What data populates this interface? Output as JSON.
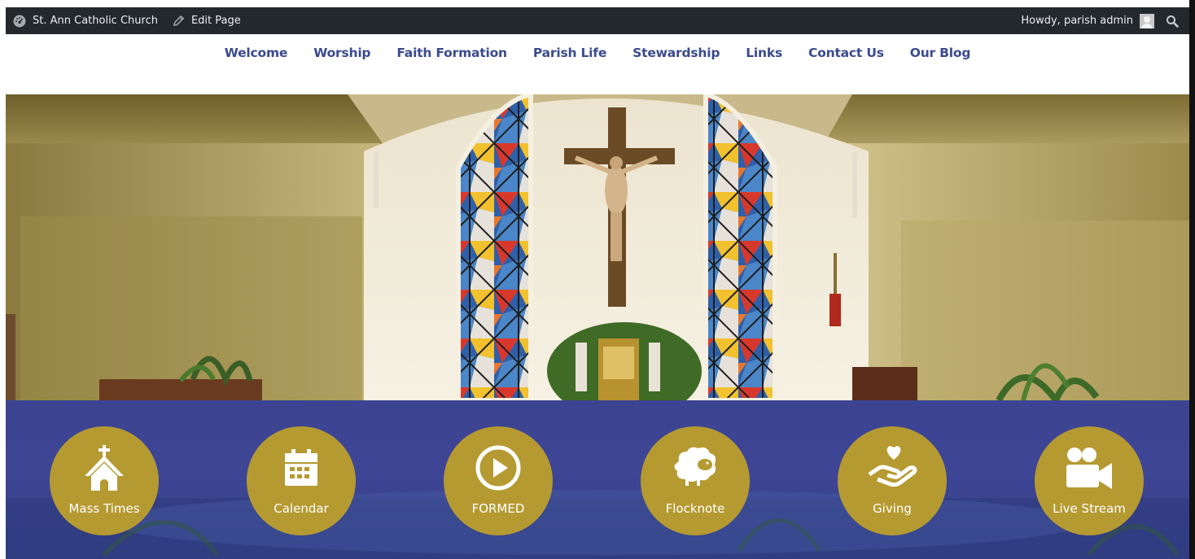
{
  "adminbar": {
    "site_name": "St. Ann Catholic Church",
    "edit_page": "Edit Page",
    "greeting": "Howdy, parish admin"
  },
  "nav": {
    "items": [
      {
        "label": "Welcome"
      },
      {
        "label": "Worship"
      },
      {
        "label": "Faith Formation"
      },
      {
        "label": "Parish Life"
      },
      {
        "label": "Stewardship"
      },
      {
        "label": "Links"
      },
      {
        "label": "Contact Us"
      },
      {
        "label": "Our Blog"
      }
    ]
  },
  "quicklinks": [
    {
      "label": "Mass Times",
      "icon": "church-icon"
    },
    {
      "label": "Calendar",
      "icon": "calendar-icon"
    },
    {
      "label": "FORMED",
      "icon": "play-circle-icon"
    },
    {
      "label": "Flocknote",
      "icon": "sheep-icon"
    },
    {
      "label": "Giving",
      "icon": "hand-heart-icon"
    },
    {
      "label": "Live Stream",
      "icon": "video-camera-icon"
    }
  ],
  "colors": {
    "adminbar_bg": "#23282d",
    "nav_text": "#3a4a8e",
    "band_bg": "#3c4491",
    "circle_gold": "#b59a31"
  }
}
